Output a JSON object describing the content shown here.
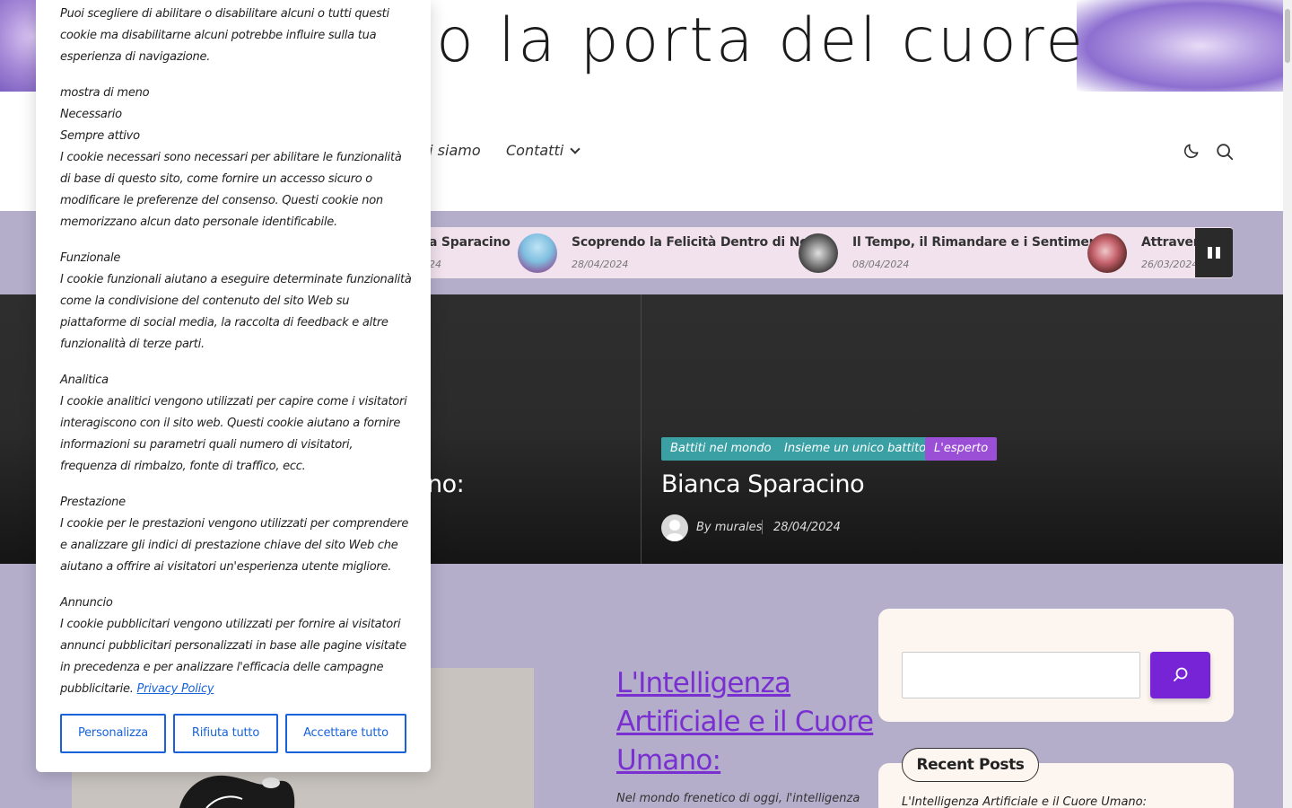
{
  "header": {
    "site_title": "no la porta del cuore"
  },
  "nav": {
    "items": [
      {
        "label": "hi siamo"
      },
      {
        "label": "Contatti"
      }
    ]
  },
  "ticker": {
    "items": [
      {
        "title": "a Sparacino",
        "date": "24"
      },
      {
        "title": "Scoprendo la Felicità Dentro di Noi",
        "date": "28/04/2024"
      },
      {
        "title": "Il Tempo, il Rimandare e i Sentimenti",
        "date": "08/04/2024"
      },
      {
        "title": "Attravers",
        "date": "26/03/2024"
      }
    ]
  },
  "hero": {
    "left_title_fragment": "ano:",
    "categories": [
      {
        "label": "Battiti nel mondo",
        "color": "#3aa0a4"
      },
      {
        "label": "Insieme un unico battito",
        "color": "#3aa0a4"
      },
      {
        "label": "L'esperto",
        "color": "#9b4fd6"
      }
    ],
    "title": "Bianca Sparacino",
    "author": "By murales",
    "date": "28/04/2024"
  },
  "main": {
    "post_title": "L'Intelligenza Artificiale e il Cuore Umano:",
    "post_excerpt": "Nel mondo frenetico di oggi, l'intelligenza"
  },
  "sidebar": {
    "search_placeholder": "",
    "recent_heading": "Recent Posts",
    "recent_first": "L'Intelligenza Artificiale e il Cuore Umano:"
  },
  "cookie": {
    "intro": "Puoi scegliere di abilitare o disabilitare alcuni o tutti questi cookie ma disabilitarne alcuni potrebbe influire sulla tua esperienza di navigazione.",
    "show_less": "mostra di meno",
    "necessary_title": "Necessario",
    "always_active": "Sempre attivo",
    "necessary_desc": "I cookie necessari sono necessari per abilitare le funzionalità di base di questo sito, come fornire un accesso sicuro o modificare le preferenze del consenso. Questi cookie non memorizzano alcun dato personale identificabile.",
    "functional_title": "Funzionale",
    "functional_desc": "I cookie funzionali aiutano a eseguire determinate funzionalità come la condivisione del contenuto del sito Web su piattaforme di social media, la raccolta di feedback e altre funzionalità di terze parti.",
    "analytics_title": "Analitica",
    "analytics_desc": "I cookie analitici vengono utilizzati per capire come i visitatori interagiscono con il sito web. Questi cookie aiutano a fornire informazioni su parametri quali numero di visitatori, frequenza di rimbalzo, fonte di traffico, ecc.",
    "performance_title": "Prestazione",
    "performance_desc": "I cookie per le prestazioni vengono utilizzati per comprendere e analizzare gli indici di prestazione chiave del sito Web che aiutano a offrire ai visitatori un'esperienza utente migliore.",
    "ads_title": "Annuncio",
    "ads_desc": "I cookie pubblicitari vengono utilizzati per fornire ai visitatori annunci pubblicitari personalizzati in base alle pagine visitate in precedenza e per analizzare l'efficacia delle campagne pubblicitarie.",
    "privacy_link": "Privacy Policy",
    "btn_customize": "Personalizza",
    "btn_reject": "Rifiuta tutto",
    "btn_accept": "Accettare tutto"
  }
}
